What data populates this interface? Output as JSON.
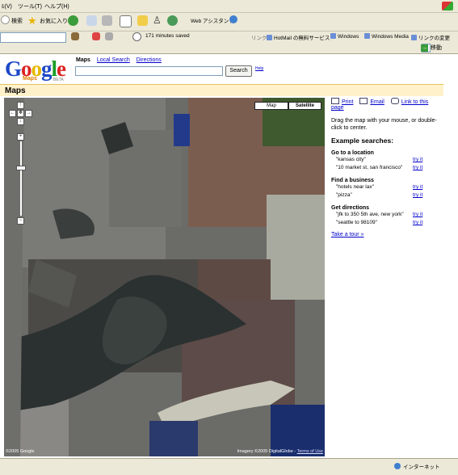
{
  "browser": {
    "menu": [
      "ﾙ(V)",
      "ツール(T)",
      "ヘルプ(H)"
    ],
    "toolbar": {
      "search_label": "検索",
      "favorites_label": "お気に入り",
      "web_assistant_label": "Web アシスタント"
    },
    "status_text": "171 minutes saved",
    "links_label": "リンク",
    "links": [
      "HotMail の無料サービス",
      "Windows",
      "Windows Media",
      "リンクの変更"
    ],
    "go_label": "移動",
    "zone_label": "インターネット"
  },
  "header": {
    "logo": {
      "letters": [
        "G",
        "o",
        "o",
        "g",
        "l",
        "e"
      ],
      "sub": "Maps",
      "beta": "BETA"
    },
    "nav": [
      "Maps",
      "Local Search",
      "Directions"
    ],
    "search": {
      "value": "",
      "button_label": "Search",
      "help_label": "Help"
    }
  },
  "maps_title": "Maps",
  "map": {
    "types": [
      "Map",
      "Satellite"
    ],
    "selected_type": "Satellite",
    "copyright_left": "©2005 Google",
    "copyright_right_prefix": "Imagery ©2005 DigitalGlobe - ",
    "terms_label": "Terms of Use",
    "controls": {
      "pan": [
        "↑",
        "←",
        "✥",
        "→",
        "↓"
      ],
      "zoom_in": "+",
      "zoom_out": "−"
    }
  },
  "sidebar": {
    "tools": [
      "Print",
      "Email",
      "Link to this page"
    ],
    "drag_hint": "Drag the map with your mouse, or double-click to center.",
    "examples_heading": "Example searches:",
    "sections": [
      {
        "heading": "Go to a location",
        "items": [
          {
            "query": "\"kansas city\"",
            "action": "try it"
          },
          {
            "query": "\"10 market st, san francisco\"",
            "action": "try it"
          }
        ]
      },
      {
        "heading": "Find a business",
        "items": [
          {
            "query": "\"hotels near lax\"",
            "action": "try it"
          },
          {
            "query": "\"pizza\"",
            "action": "try it"
          }
        ]
      },
      {
        "heading": "Get directions",
        "items": [
          {
            "query": "\"jfk to 350 5th ave, new york\"",
            "action": "try it"
          },
          {
            "query": "\"seattle to 98109\"",
            "action": "try it"
          }
        ]
      }
    ],
    "tour_label": "Take a tour »"
  }
}
